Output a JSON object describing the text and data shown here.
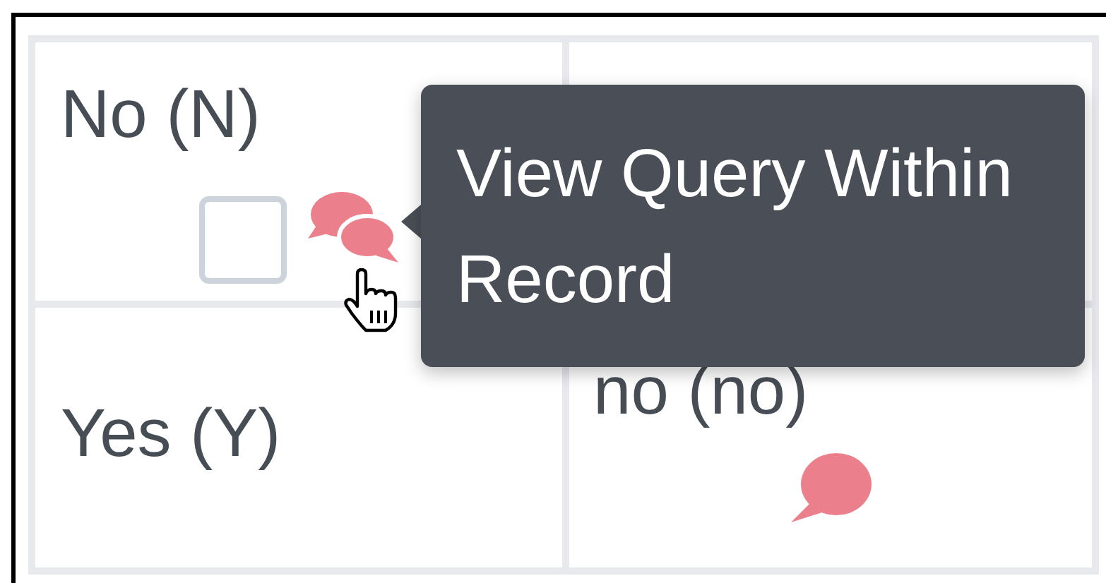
{
  "table": {
    "rows": [
      {
        "cells": [
          {
            "label": "No (N)",
            "checkbox": {
              "checked": false
            },
            "query_icon": {
              "kind": "double"
            }
          }
        ]
      },
      {
        "cells": [
          {
            "label": "Yes (Y)"
          },
          {
            "label": "no (no)",
            "query_icon": {
              "kind": "single"
            }
          }
        ]
      }
    ]
  },
  "tooltip": {
    "text": "View Query Within Record"
  }
}
